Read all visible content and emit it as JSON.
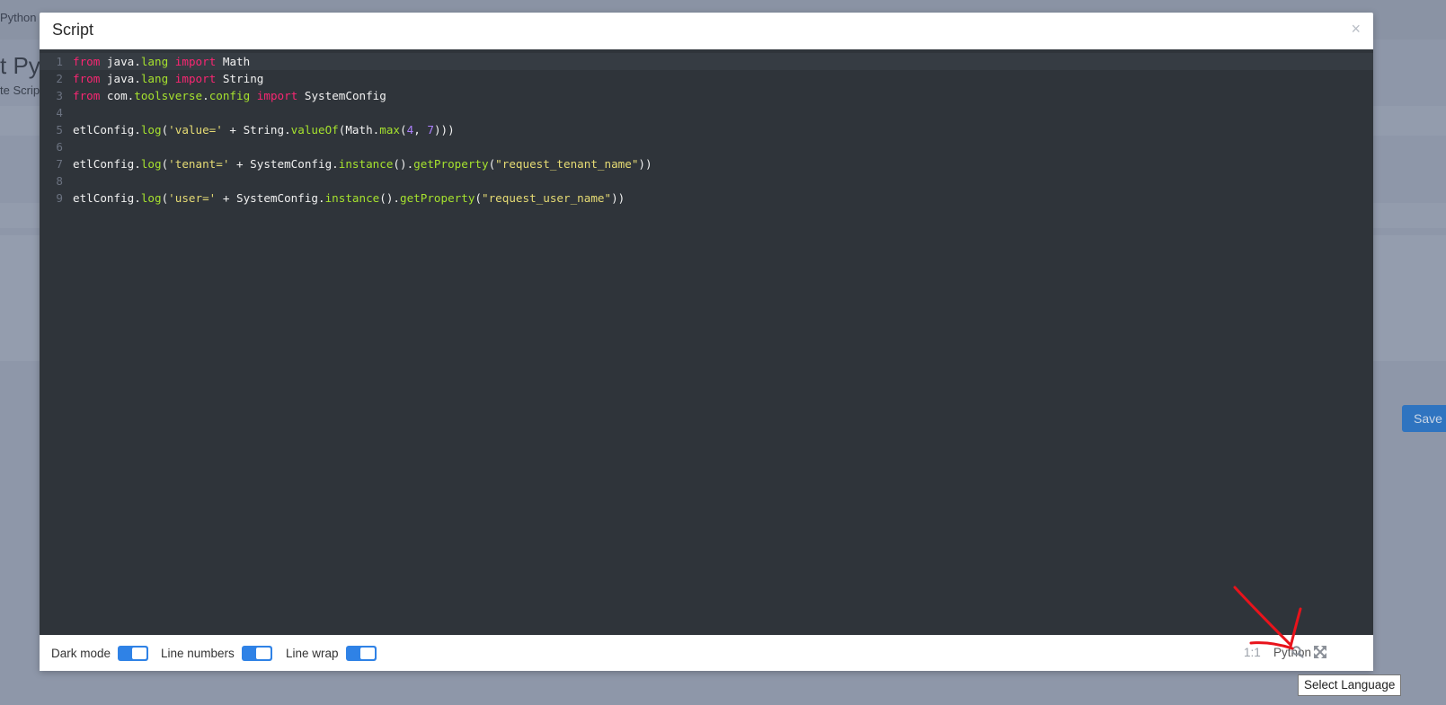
{
  "background": {
    "breadcrumb": "Python s",
    "page_title": "t Pyt",
    "page_subtitle": "te Scrip",
    "save_button": "Save"
  },
  "modal": {
    "title": "Script",
    "close_symbol": "×"
  },
  "editor": {
    "lines": [
      {
        "num": "1",
        "active": true,
        "tokens": [
          {
            "t": "from",
            "c": "kw"
          },
          {
            "t": " java.",
            "c": "id"
          },
          {
            "t": "lang",
            "c": "mem"
          },
          {
            "t": " ",
            "c": "id"
          },
          {
            "t": "import",
            "c": "kw"
          },
          {
            "t": " Math",
            "c": "id"
          }
        ]
      },
      {
        "num": "2",
        "tokens": [
          {
            "t": "from",
            "c": "kw"
          },
          {
            "t": " java.",
            "c": "id"
          },
          {
            "t": "lang",
            "c": "mem"
          },
          {
            "t": " ",
            "c": "id"
          },
          {
            "t": "import",
            "c": "kw"
          },
          {
            "t": " String",
            "c": "id"
          }
        ]
      },
      {
        "num": "3",
        "tokens": [
          {
            "t": "from",
            "c": "kw"
          },
          {
            "t": " com.",
            "c": "id"
          },
          {
            "t": "toolsverse",
            "c": "mem"
          },
          {
            "t": ".",
            "c": "id"
          },
          {
            "t": "config",
            "c": "mem"
          },
          {
            "t": " ",
            "c": "id"
          },
          {
            "t": "import",
            "c": "kw"
          },
          {
            "t": " SystemConfig",
            "c": "id"
          }
        ]
      },
      {
        "num": "4",
        "tokens": []
      },
      {
        "num": "5",
        "tokens": [
          {
            "t": "etlConfig.",
            "c": "id"
          },
          {
            "t": "log",
            "c": "mem"
          },
          {
            "t": "(",
            "c": "id"
          },
          {
            "t": "'value='",
            "c": "str"
          },
          {
            "t": " + String.",
            "c": "id"
          },
          {
            "t": "valueOf",
            "c": "mem"
          },
          {
            "t": "(Math.",
            "c": "id"
          },
          {
            "t": "max",
            "c": "mem"
          },
          {
            "t": "(",
            "c": "id"
          },
          {
            "t": "4",
            "c": "num"
          },
          {
            "t": ", ",
            "c": "id"
          },
          {
            "t": "7",
            "c": "num"
          },
          {
            "t": ")))",
            "c": "id"
          }
        ]
      },
      {
        "num": "6",
        "tokens": []
      },
      {
        "num": "7",
        "tokens": [
          {
            "t": "etlConfig.",
            "c": "id"
          },
          {
            "t": "log",
            "c": "mem"
          },
          {
            "t": "(",
            "c": "id"
          },
          {
            "t": "'tenant='",
            "c": "str"
          },
          {
            "t": " + SystemConfig.",
            "c": "id"
          },
          {
            "t": "instance",
            "c": "mem"
          },
          {
            "t": "().",
            "c": "id"
          },
          {
            "t": "getProperty",
            "c": "mem"
          },
          {
            "t": "(",
            "c": "id"
          },
          {
            "t": "\"request_tenant_name\"",
            "c": "str"
          },
          {
            "t": "))",
            "c": "id"
          }
        ]
      },
      {
        "num": "8",
        "tokens": []
      },
      {
        "num": "9",
        "tokens": [
          {
            "t": "etlConfig.",
            "c": "id"
          },
          {
            "t": "log",
            "c": "mem"
          },
          {
            "t": "(",
            "c": "id"
          },
          {
            "t": "'user='",
            "c": "str"
          },
          {
            "t": " + SystemConfig.",
            "c": "id"
          },
          {
            "t": "instance",
            "c": "mem"
          },
          {
            "t": "().",
            "c": "id"
          },
          {
            "t": "getProperty",
            "c": "mem"
          },
          {
            "t": "(",
            "c": "id"
          },
          {
            "t": "\"request_user_name\"",
            "c": "str"
          },
          {
            "t": "))",
            "c": "id"
          }
        ]
      }
    ]
  },
  "footer": {
    "toggles": [
      {
        "label": "Dark mode",
        "on": true
      },
      {
        "label": "Line numbers",
        "on": true
      },
      {
        "label": "Line wrap",
        "on": true
      }
    ],
    "cursor_position": "1:1",
    "language": "Python",
    "search_icon": "search-icon",
    "fullscreen_icon": "fullscreen-icon"
  },
  "tooltip": {
    "text": "Select Language"
  },
  "annotation": {
    "arrow_color": "#e8131b"
  }
}
